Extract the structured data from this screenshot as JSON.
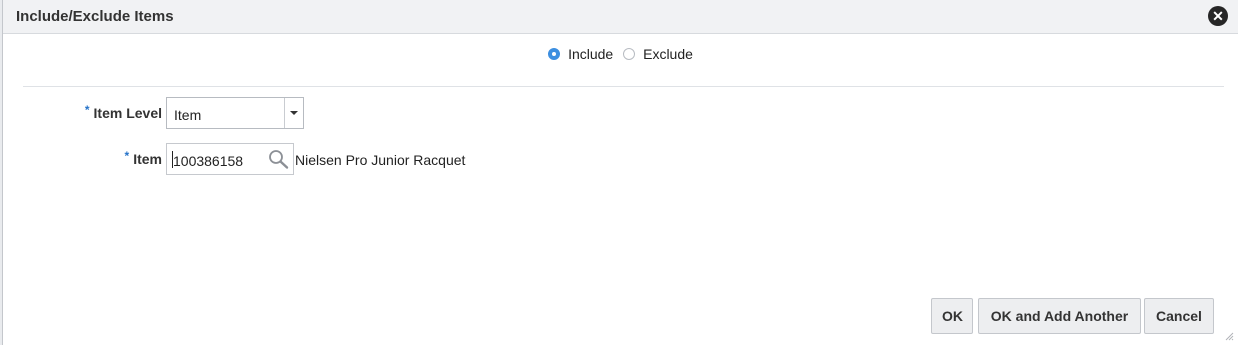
{
  "dialog": {
    "title": "Include/Exclude Items",
    "close_icon": "close-circle-icon"
  },
  "mode": {
    "options": [
      {
        "label": "Include",
        "selected": true
      },
      {
        "label": "Exclude",
        "selected": false
      }
    ]
  },
  "form": {
    "required_marker": "*",
    "item_level": {
      "label": "Item Level",
      "value": "Item",
      "icon": "chevron-down-icon"
    },
    "item": {
      "label": "Item",
      "value": "100386158",
      "description": "Nielsen Pro Junior Racquet",
      "icon": "search-icon"
    }
  },
  "buttons": {
    "ok": "OK",
    "ok_add_another": "OK and Add Another",
    "cancel": "Cancel"
  },
  "colors": {
    "accent": "#3d8fe0",
    "required": "#2673c9"
  }
}
